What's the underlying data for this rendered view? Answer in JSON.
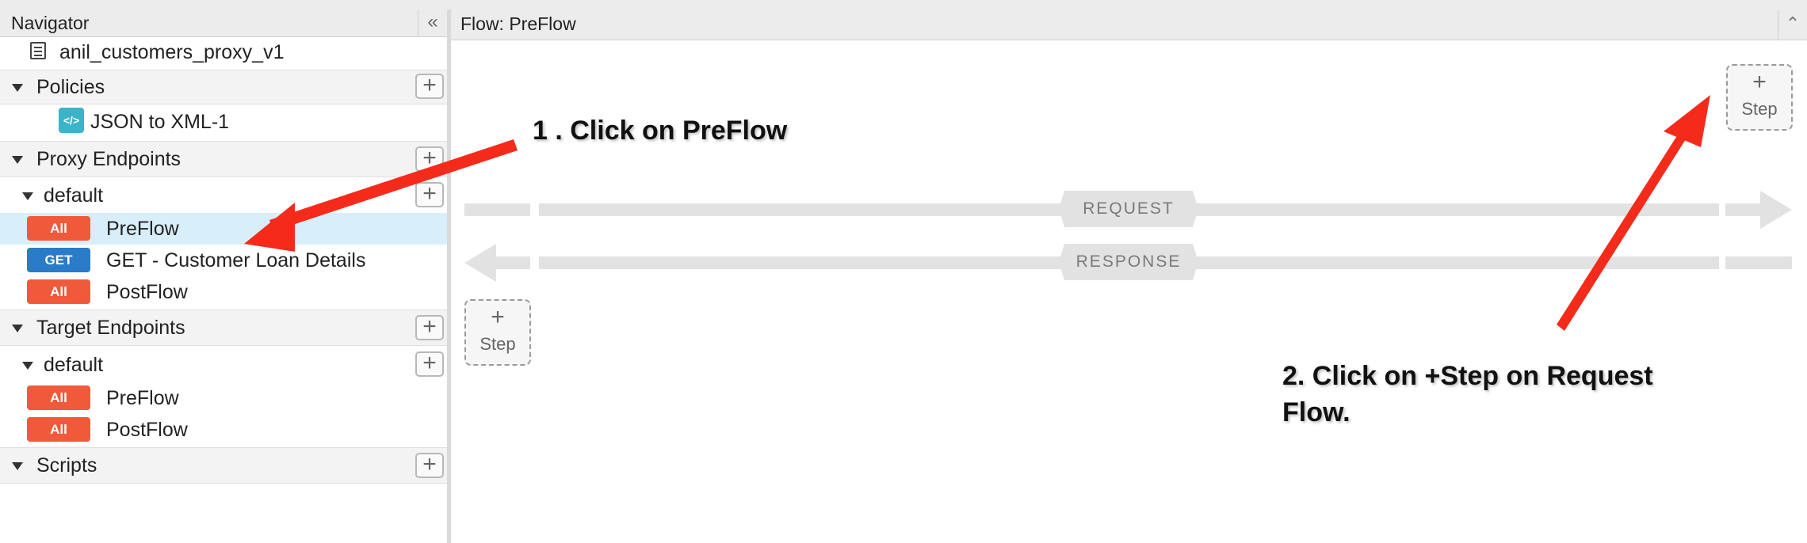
{
  "navigator": {
    "title": "Navigator",
    "collapse_glyph": "«",
    "proxy_name": "anil_customers_proxy_v1",
    "sections": {
      "policies": "Policies",
      "proxy_endpoints": "Proxy Endpoints",
      "target_endpoints": "Target Endpoints",
      "scripts": "Scripts"
    },
    "policy_items": [
      {
        "label": "JSON to XML-1",
        "icon": "json-xml-policy-icon"
      }
    ],
    "proxy_default": "default",
    "proxy_flows": [
      {
        "badge": "All",
        "label": "PreFlow",
        "selected": true
      },
      {
        "badge": "GET",
        "label": "GET - Customer Loan Details",
        "selected": false
      },
      {
        "badge": "All",
        "label": "PostFlow",
        "selected": false
      }
    ],
    "target_default": "default",
    "target_flows": [
      {
        "badge": "All",
        "label": "PreFlow"
      },
      {
        "badge": "All",
        "label": "PostFlow"
      }
    ],
    "add_glyph": "+"
  },
  "flow": {
    "title": "Flow: PreFlow",
    "collapse_glyph": "⌃",
    "request_label": "REQUEST",
    "response_label": "RESPONSE",
    "step_plus": "+",
    "step_label": "Step"
  },
  "annotations": {
    "one": "1 . Click on PreFlow",
    "two_line1": "2. Click on +Step on Request",
    "two_line2": "Flow."
  },
  "colors": {
    "badge_all": "#f05a3a",
    "badge_get": "#2a7bc8",
    "selected_row": "#d8eefa",
    "annotation_arrow": "#f42b1b"
  }
}
